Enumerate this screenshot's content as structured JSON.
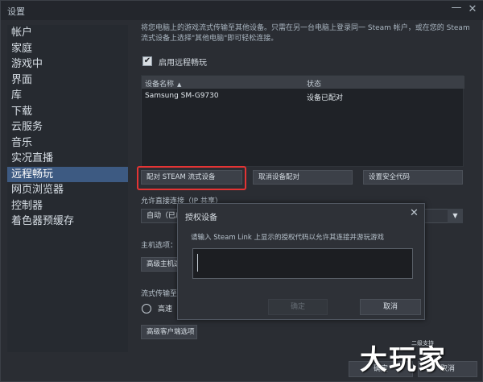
{
  "window": {
    "title": "设置",
    "minimize_glyph": "—",
    "close_glyph": "✕"
  },
  "sidebar": {
    "items": [
      {
        "label": "帐户"
      },
      {
        "label": "家庭"
      },
      {
        "label": "游戏中"
      },
      {
        "label": "界面"
      },
      {
        "label": "库"
      },
      {
        "label": "下载"
      },
      {
        "label": "云服务"
      },
      {
        "label": "音乐"
      },
      {
        "label": "实况直播"
      },
      {
        "label": "远程畅玩"
      },
      {
        "label": "网页浏览器"
      },
      {
        "label": "控制器"
      },
      {
        "label": "着色器预缓存"
      }
    ],
    "active_index": 9
  },
  "main": {
    "description": "将您电脑上的游戏流式传输至其他设备。只需在另一台电脑上登录同一 Steam 帐户，或在您的 Steam 流式设备上选择\"其他电脑\"即可轻松连接。",
    "enable_checkbox": {
      "label": "启用远程畅玩",
      "checked": true,
      "check_glyph": "✔"
    },
    "devices_table": {
      "columns": [
        "设备名称",
        "状态"
      ],
      "sort_glyph": "▲",
      "rows": [
        {
          "name": "Samsung SM-G9730",
          "status": "设备已配对"
        }
      ]
    },
    "buttons": {
      "pair": "配对 STEAM 流式设备",
      "cancel_pair": "取消设备配对",
      "set_security_code": "设置安全代码"
    },
    "direct_connect": {
      "label": "允许直接连接（IP 共享）",
      "value": "自动（已启",
      "arrow_glyph": "▼"
    },
    "host_options": {
      "label": "主机选项：",
      "advanced_button": "高级主机选"
    },
    "streaming": {
      "label": "流式传输至",
      "radio_label": "高速",
      "advanced_button": "高级客户端选项"
    },
    "footer": {
      "ok": "确定",
      "cancel": "取消"
    }
  },
  "dialog": {
    "title": "授权设备",
    "close_glyph": "✕",
    "prompt": "请输入 Steam Link 上显示的授权代码以允许其连接并游玩游戏",
    "input_value": "",
    "confirm": "确定",
    "cancel": "取消"
  },
  "watermark": {
    "text": "大玩家",
    "small_text": "二级支持"
  }
}
